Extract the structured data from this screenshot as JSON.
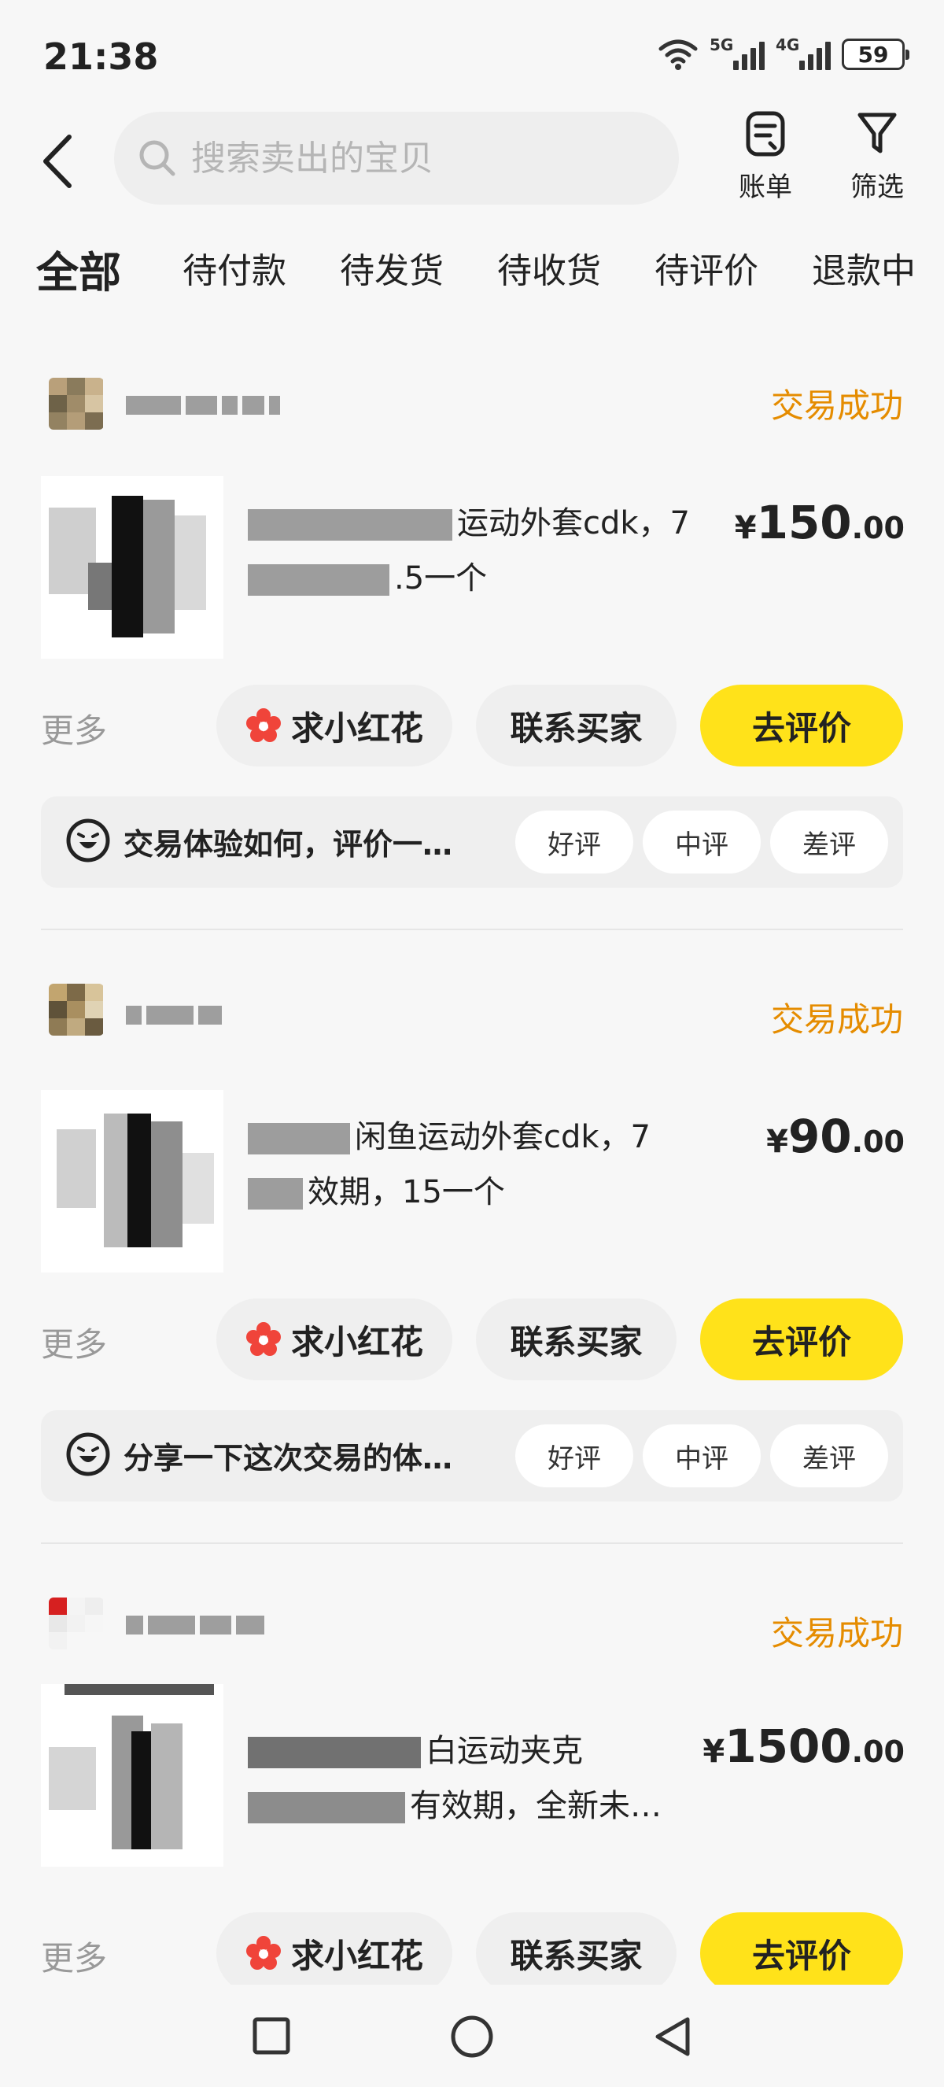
{
  "status_bar": {
    "time": "21:38",
    "net1": "5G",
    "net2": "4G",
    "battery": "59"
  },
  "header": {
    "search_placeholder": "搜索卖出的宝贝",
    "bill_label": "账单",
    "filter_label": "筛选"
  },
  "tabs": [
    "全部",
    "待付款",
    "待发货",
    "待收货",
    "待评价",
    "退款中"
  ],
  "orders": [
    {
      "status": "交易成功",
      "title_line1": "运动外套cdk，7",
      "title_line2": ".5一个",
      "price_currency": "¥",
      "price_int": "150",
      "price_dec": ".00",
      "more": "更多",
      "btn_flower": "求小红花",
      "btn_contact": "联系买家",
      "btn_review": "去评价",
      "review_prompt": "交易体验如何，评价一…",
      "good": "好评",
      "mid": "中评",
      "bad": "差评"
    },
    {
      "status": "交易成功",
      "title_line1": "闲鱼运动外套cdk，7",
      "title_line2": "效期，15一个",
      "price_currency": "¥",
      "price_int": "90",
      "price_dec": ".00",
      "more": "更多",
      "btn_flower": "求小红花",
      "btn_contact": "联系买家",
      "btn_review": "去评价",
      "review_prompt": "分享一下这次交易的体…",
      "good": "好评",
      "mid": "中评",
      "bad": "差评"
    },
    {
      "status": "交易成功",
      "title_line1": "白运动夹克",
      "title_line2": "有效期，全新未…",
      "price_currency": "¥",
      "price_int": "1500",
      "price_dec": ".00",
      "more": "更多",
      "btn_flower": "求小红花",
      "btn_contact": "联系买家",
      "btn_review": "去评价"
    }
  ],
  "colors": {
    "accent": "#ffe21a",
    "status": "#e58c00",
    "flower": "#f0443a"
  },
  "icons": [
    "back-arrow-icon",
    "search-icon",
    "bill-icon",
    "filter-icon",
    "flower-icon",
    "face-icon",
    "square-nav-icon",
    "circle-nav-icon",
    "triangle-nav-icon"
  ]
}
